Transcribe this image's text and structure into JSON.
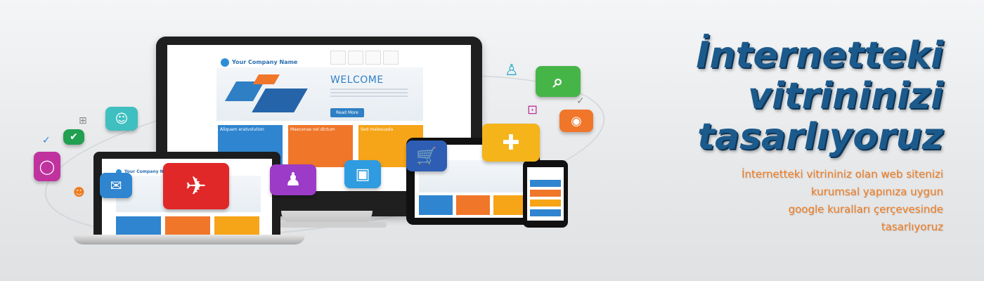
{
  "headline": {
    "line1": "İnternetteki",
    "line2": "vitrininizi",
    "line3": "tasarlıyoruz"
  },
  "subtext": {
    "line1": "İnternetteki vitrininiz olan web sitenizi",
    "line2": "kurumsal yapınıza uygun",
    "line3": "google kuralları çerçevesinde",
    "line4": "tasarlıyoruz"
  },
  "mockup": {
    "company_name": "Your Company Name",
    "welcome": "WELCOME",
    "read_more": "Read More",
    "tile1": "Aliquam eratvolution",
    "tile2": "Maecenas vel dictum",
    "tile3": "Sed malesuada"
  },
  "colors": {
    "headline": "#1c5a8c",
    "subtext": "#f07a1c",
    "accent_blue": "#2f85cf",
    "accent_orange": "#f0762a"
  },
  "icons": [
    "chat-icon",
    "email-icon",
    "airplane-icon",
    "person-icon",
    "video-icon",
    "shopping-cart-icon",
    "gamepad-icon",
    "search-icon",
    "rss-icon",
    "user-card-icon",
    "check-icon"
  ]
}
